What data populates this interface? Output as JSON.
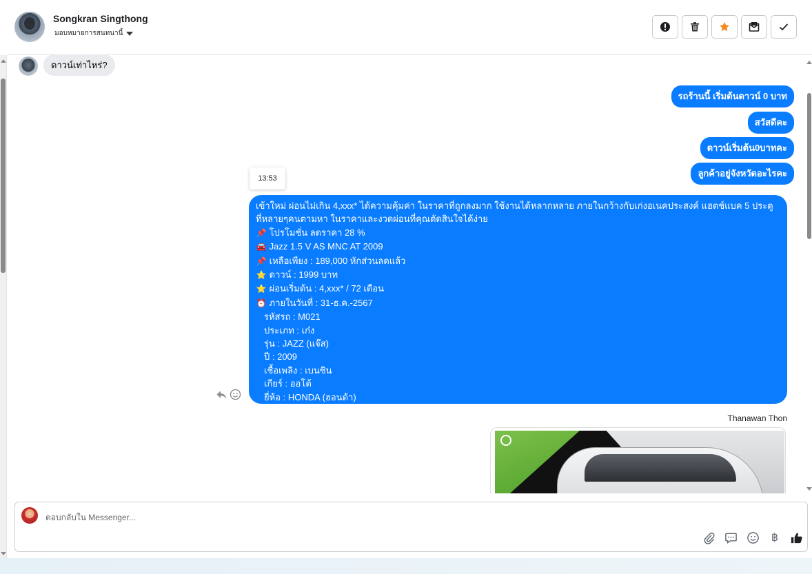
{
  "header": {
    "contact_name": "Songkran Singthong",
    "assign_label": "มอบหมายการสนทนานี้",
    "actions": [
      "report",
      "delete",
      "star",
      "mark-unread",
      "done"
    ],
    "accent_star_color": "#f28a1e"
  },
  "conversation": {
    "incoming_first": "ดาวน์เท่าไหร่?",
    "outgoing": [
      "รถร้านนี้ เริ่มต้นดาวน์ 0 บาท",
      "สวัสดีคะ",
      "ดาวน์เริ่มต้น0บาทคะ",
      "ลูกค้าอยู่จังหวัดอะไรคะ"
    ],
    "timestamp_tooltip": "13:53",
    "big_message": {
      "intro": "เข้าใหม่ ผ่อนไม่เกิน 4,xxx* ได้ความคุ้มค่า ในราคาที่ถูกลงมาก ใช้งานได้หลากหลาย ภายในกว้างกับเก่งอเนคประสงค์ แฮตช์แบค 5 ประตู ที่หลายๆคนตามหา ในราคาและงวดผ่อนที่คุณตัดสินใจได้ง่าย",
      "lines": [
        {
          "emoji": "📌",
          "text": "โปรโมชั่น ลดราคา 28 %"
        },
        {
          "emoji": "🚘",
          "text": "Jazz 1.5 V AS MNC AT 2009"
        },
        {
          "emoji": "📌",
          "text": "เหลือเพียง : 189,000 หักส่วนลดแล้ว"
        },
        {
          "emoji": "⭐",
          "text": "ดาวน์ : 1999 บาท"
        },
        {
          "emoji": "⭐",
          "text": "ผ่อนเริ่มต้น : 4,xxx* / 72 เดือน"
        },
        {
          "emoji": "⏰",
          "text": "ภายในวันที่ : 31-ธ.ค.-2567"
        }
      ],
      "specs": [
        "รหัสรถ : M021",
        "ประเภท : เก๋ง",
        "รุ่น : JAZZ (แจ๊ส)",
        "ปี : 2009",
        "เชื้อเพลิง : เบนซิน",
        "เกียร์ : ออโต้",
        "ยี่ห้อ : HONDA (ฮอนด้า)"
      ]
    },
    "sender_name": "Thanawan Thon"
  },
  "composer": {
    "placeholder": "ตอบกลับใน Messenger...",
    "baht_symbol": "฿",
    "tools": [
      "attach-icon",
      "saved-replies-icon",
      "emoji-icon",
      "baht-icon",
      "like-icon"
    ]
  },
  "colors": {
    "bubble_blue": "#0a7cff",
    "incoming_grey": "#e9ebee"
  }
}
